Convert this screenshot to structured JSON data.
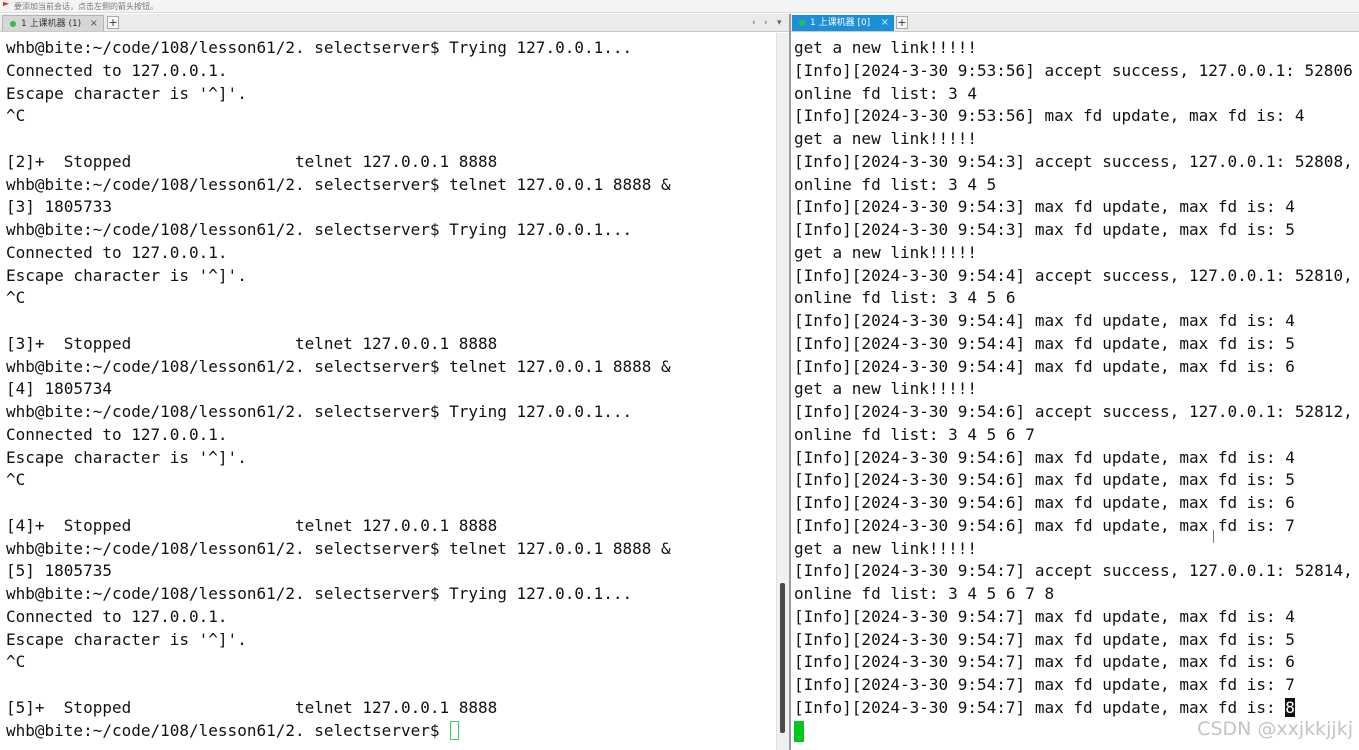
{
  "hint": "要添加当前会话，点击左侧的箭头按钮。",
  "tabs": {
    "left": {
      "label": "1 上课机器 (1)",
      "close": "×",
      "add": "+",
      "nav_prev": "‹",
      "nav_next": "›",
      "nav_menu": "▾"
    },
    "right": {
      "label": "1 上课机器 [0]",
      "close": "×",
      "add": "+"
    }
  },
  "left_terminal": {
    "lines": [
      "whb@bite:~/code/108/lesson61/2. selectserver$ Trying 127.0.0.1...",
      "Connected to 127.0.0.1.",
      "Escape character is '^]'.",
      "^C",
      "",
      "[2]+  Stopped                 telnet 127.0.0.1 8888",
      "whb@bite:~/code/108/lesson61/2. selectserver$ telnet 127.0.0.1 8888 &",
      "[3] 1805733",
      "whb@bite:~/code/108/lesson61/2. selectserver$ Trying 127.0.0.1...",
      "Connected to 127.0.0.1.",
      "Escape character is '^]'.",
      "^C",
      "",
      "[3]+  Stopped                 telnet 127.0.0.1 8888",
      "whb@bite:~/code/108/lesson61/2. selectserver$ telnet 127.0.0.1 8888 &",
      "[4] 1805734",
      "whb@bite:~/code/108/lesson61/2. selectserver$ Trying 127.0.0.1...",
      "Connected to 127.0.0.1.",
      "Escape character is '^]'.",
      "^C",
      "",
      "[4]+  Stopped                 telnet 127.0.0.1 8888",
      "whb@bite:~/code/108/lesson61/2. selectserver$ telnet 127.0.0.1 8888 &",
      "[5] 1805735",
      "whb@bite:~/code/108/lesson61/2. selectserver$ Trying 127.0.0.1...",
      "Connected to 127.0.0.1.",
      "Escape character is '^]'.",
      "^C",
      "",
      "[5]+  Stopped                 telnet 127.0.0.1 8888"
    ],
    "prompt": "whb@bite:~/code/108/lesson61/2. selectserver$ "
  },
  "right_terminal": {
    "lines": [
      "get a new link!!!!!",
      "[Info][2024-3-30 9:53:56] accept success, 127.0.0.1: 52806",
      "online fd list: 3 4",
      "[Info][2024-3-30 9:53:56] max fd update, max fd is: 4",
      "get a new link!!!!!",
      "[Info][2024-3-30 9:54:3] accept success, 127.0.0.1: 52808,",
      "online fd list: 3 4 5",
      "[Info][2024-3-30 9:54:3] max fd update, max fd is: 4",
      "[Info][2024-3-30 9:54:3] max fd update, max fd is: 5",
      "get a new link!!!!!",
      "[Info][2024-3-30 9:54:4] accept success, 127.0.0.1: 52810,",
      "online fd list: 3 4 5 6",
      "[Info][2024-3-30 9:54:4] max fd update, max fd is: 4",
      "[Info][2024-3-30 9:54:4] max fd update, max fd is: 5",
      "[Info][2024-3-30 9:54:4] max fd update, max fd is: 6",
      "get a new link!!!!!",
      "[Info][2024-3-30 9:54:6] accept success, 127.0.0.1: 52812,",
      "online fd list: 3 4 5 6 7",
      "[Info][2024-3-30 9:54:6] max fd update, max fd is: 4",
      "[Info][2024-3-30 9:54:6] max fd update, max fd is: 5",
      "[Info][2024-3-30 9:54:6] max fd update, max fd is: 6",
      "[Info][2024-3-30 9:54:6] max fd update, max fd is: 7",
      "get a new link!!!!!",
      "[Info][2024-3-30 9:54:7] accept success, 127.0.0.1: 52814,",
      "online fd list: 3 4 5 6 7 8",
      "[Info][2024-3-30 9:54:7] max fd update, max fd is: 4",
      "[Info][2024-3-30 9:54:7] max fd update, max fd is: 5",
      "[Info][2024-3-30 9:54:7] max fd update, max fd is: 6",
      "[Info][2024-3-30 9:54:7] max fd update, max fd is: 7"
    ],
    "last_line_prefix": "[Info][2024-3-30 9:54:7] max fd update, max fd is: ",
    "last_line_value": "8"
  },
  "watermark": "CSDN @xxjkkjjkj",
  "colors": {
    "tab_active": "#1b8fd8",
    "cursor_green": "#00c81e",
    "status_dot": "#2ebd4e"
  }
}
